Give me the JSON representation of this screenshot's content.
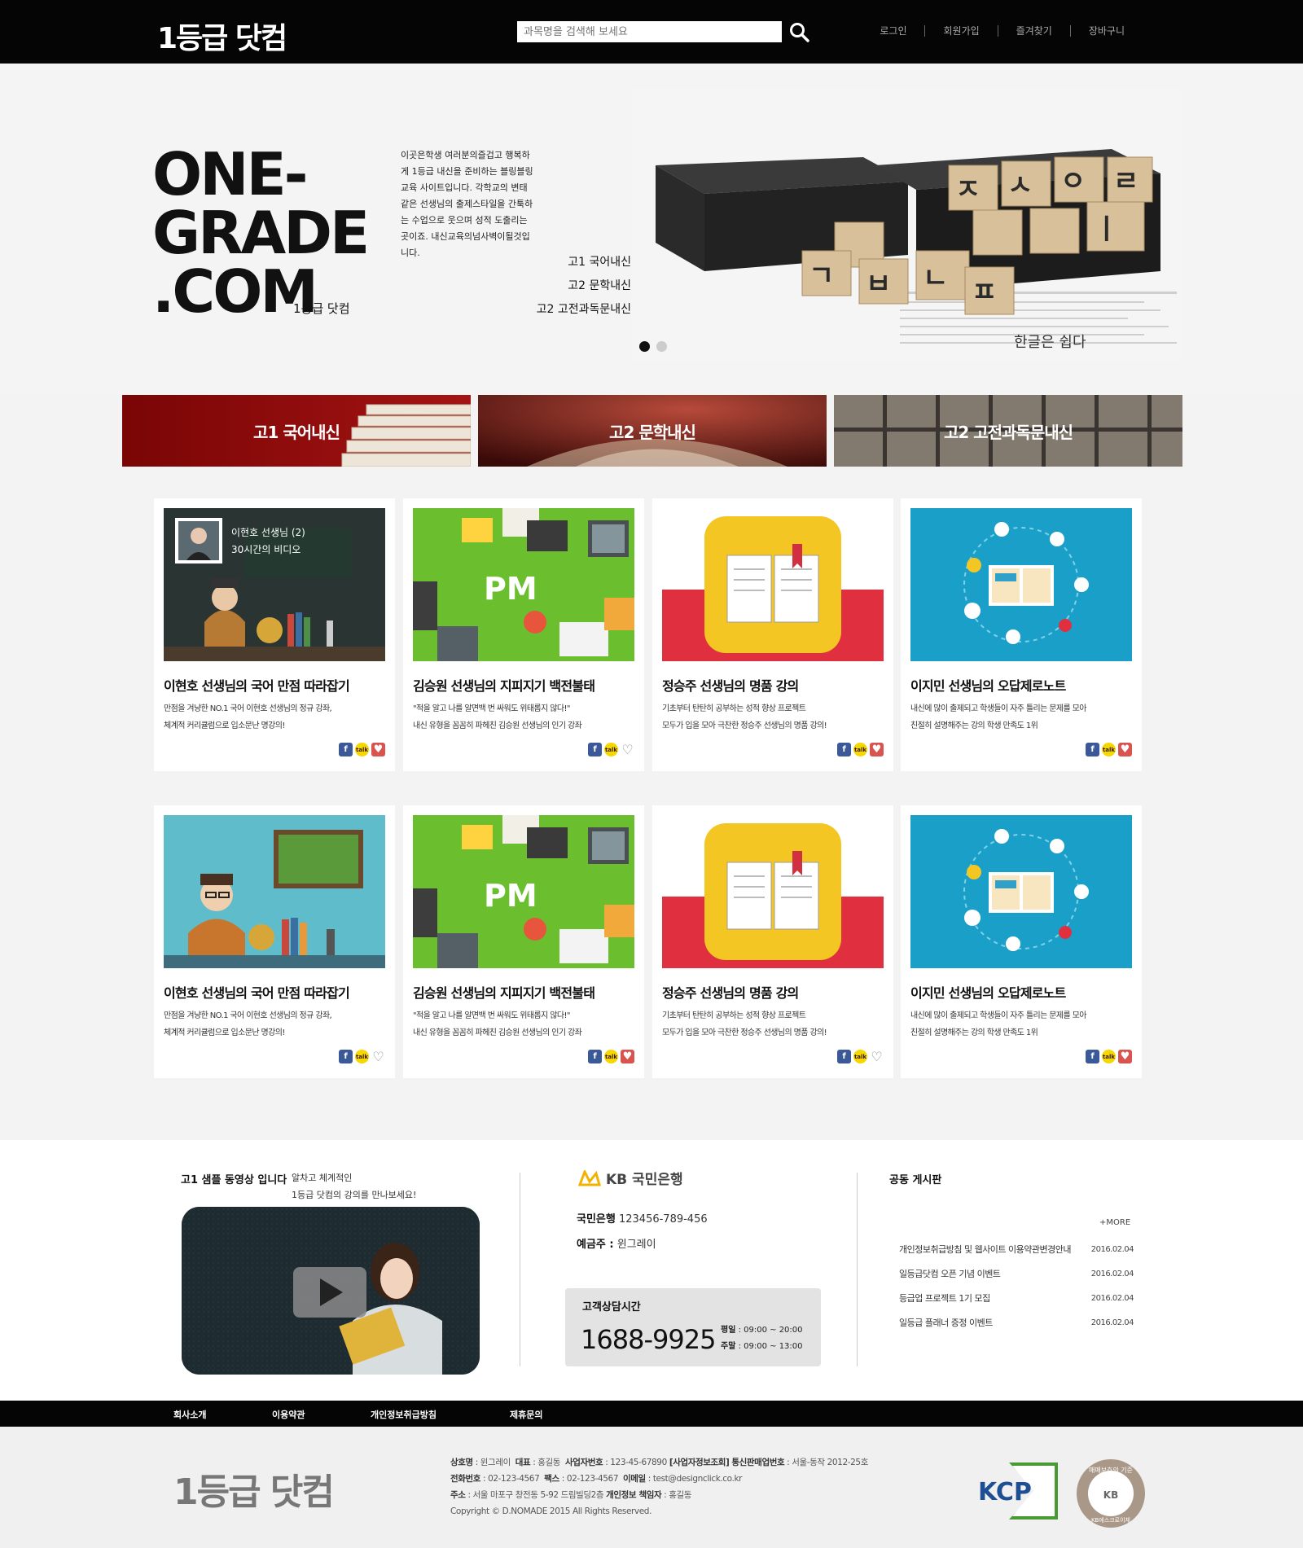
{
  "header": {
    "logo": "1등급 닷컴",
    "search_placeholder": "과목명을 검색해 보세요",
    "nav": [
      "로그인",
      "회원가입",
      "즐겨찾기",
      "장바구니"
    ]
  },
  "hero": {
    "title_lines": [
      "ONE-",
      "GRADE",
      ".COM"
    ],
    "subtitle": "1등급 닷컴",
    "description": "이곳은학생 여러분의즐겁고 행복하게 1등급 내신을 준비하는 블링블링 교육 사이트입니다. 각학교의 변태 같은 선생님의 출제스타일을 간툭하는 수업으로 웃으며 성적 도출리는 곳이죠. 내신교육의넘사벽이될것입니다.",
    "links": [
      "고1 국어내신",
      "고2 문학내신",
      "고2 고전과독문내신"
    ],
    "slide_count": 2,
    "active_slide": 1
  },
  "categories": [
    {
      "label": "고1 국어내신"
    },
    {
      "label": "고2 문학내신"
    },
    {
      "label": "고2 고전과독문내신"
    }
  ],
  "featured_video": {
    "teacher": "이현호 선생님 (2)",
    "caption": "30시간의 비디오"
  },
  "cards": [
    {
      "title": "이현호 선생님의 국어 만점 따라잡기",
      "desc1": "만점을 겨냥한 NO.1 국어 이현호 선생님의 정규 강좌,",
      "desc2": "체계적 커리큘럼으로 입소문난 명강의!",
      "liked": true
    },
    {
      "title": "김승원 선생님의 지피지기 백전불태",
      "desc1": "\"적을 알고 나를 알면백 번 싸워도 위태롭지 않다!\"",
      "desc2": "내신 유형을 꼼꼼히 파헤친 김승원 선생님의 인기 강좌",
      "liked": false
    },
    {
      "title": "정승주 선생님의 명품 강의",
      "desc1": "기초부터 탄탄히 공부하는 성적 향상 프로젝트",
      "desc2": "모두가 입을 모아 극찬한 정승주 선생님의 명품 강의!",
      "liked": true
    },
    {
      "title": "이지민 선생님의 오답제로노트",
      "desc1": "내신에 많이 출제되고 학생들이 자주 틀리는 문제를 모아",
      "desc2": "친절히 설명해주는 강의 학생 만족도 1위",
      "liked": true
    },
    {
      "title": "이현호 선생님의 국어 만점 따라잡기",
      "desc1": "만점을 겨냥한 NO.1 국어 이현호 선생님의 정규 강좌,",
      "desc2": "체계적 커리큘럼으로 입소문난 명강의!",
      "liked": false
    },
    {
      "title": "김승원 선생님의 지피지기 백전불태",
      "desc1": "\"적을 알고 나를 알면백 번 싸워도 위태롭지 않다!\"",
      "desc2": "내신 유형을 꼼꼼히 파헤친 김승원 선생님의 인기 강좌",
      "liked": true
    },
    {
      "title": "정승주 선생님의 명품 강의",
      "desc1": "기초부터 탄탄히 공부하는 성적 향상 프로젝트",
      "desc2": "모두가 입을 모아 극찬한 정승주 선생님의 명품 강의!",
      "liked": false
    },
    {
      "title": "이지민 선생님의 오답제로노트",
      "desc1": "내신에 많이 출제되고 학생들이 자주 틀리는 문제를 모아",
      "desc2": "친절히 설명해주는 강의 학생 만족도 1위",
      "liked": true
    }
  ],
  "share_labels": {
    "facebook": "f",
    "kakao": "talk"
  },
  "sample_video": {
    "title": "고1 샘플 동영상 입니다",
    "subtitle1": "알차고 체계적인",
    "subtitle2": "1등급 닷컴의 강의를 만나보세요!"
  },
  "bank": {
    "logo": "KB 국민은행",
    "account_label": "국민은행",
    "account_number": "123456-789-456",
    "holder_label": "예금주 :",
    "holder": "윈그레이"
  },
  "customer_service": {
    "title": "고객상담시간",
    "phone": "1688-9925",
    "weekday_label": "평일",
    "weekday_hours": ": 09:00 ~ 20:00",
    "weekend_label": "주말",
    "weekend_hours": ": 09:00 ~ 13:00"
  },
  "board": {
    "title": "공동 게시판",
    "more": "+MORE",
    "items": [
      {
        "title": "개인정보취급방침 및 웹사이트 이용약관변경안내",
        "date": "2016.02.04"
      },
      {
        "title": "일등급닷컴 오픈 기념 이벤트",
        "date": "2016.02.04"
      },
      {
        "title": "등급업 프로젝트 1기 모집",
        "date": "2016.02.04"
      },
      {
        "title": "일등급 플래너 증정 이벤트",
        "date": "2016.02.04"
      }
    ]
  },
  "footer_nav": [
    "회사소개",
    "이용약관",
    "개인정보취급방침",
    "제휴문의"
  ],
  "footer": {
    "logo": "1등급 닷컴",
    "company_label": "상호명",
    "company": "윈그레이",
    "ceo_label": "대표",
    "ceo": "홍길동",
    "bizno_label": "사업자번호",
    "bizno": "123-45-67890",
    "bizcheck": "[사업자정보조회]",
    "mailorder_label": "통신판매업번호",
    "mailorder": "서울-동작 2012-25호",
    "phone_label": "전화번호",
    "phone": "02-123-4567",
    "fax_label": "팩스",
    "fax": "02-123-4567",
    "email_label": "이메일",
    "email": "test@designclick.co.kr",
    "address_label": "주소",
    "address": "서울 마포구 창전동 5-92 드림빌딩2층",
    "privacy_label": "개인정보 책임자",
    "privacy": "홍길동",
    "copyright": "Copyright © D.NOMADE 2015 All Rights Reserved.",
    "kcp": "KCP",
    "kb_seal": "KB에스크로이체",
    "kb_seal_top": "매매보호의 기준"
  },
  "colors": {
    "header_bg": "#050505",
    "cat1": "#8c0c0c",
    "cat2": "#6b1410",
    "green_thumb": "#6bbf2e",
    "red_band": "#e03040",
    "yellow_book": "#f3c623",
    "blue_thumb": "#1aa0c8",
    "teal_thumb": "#5fbccb"
  }
}
